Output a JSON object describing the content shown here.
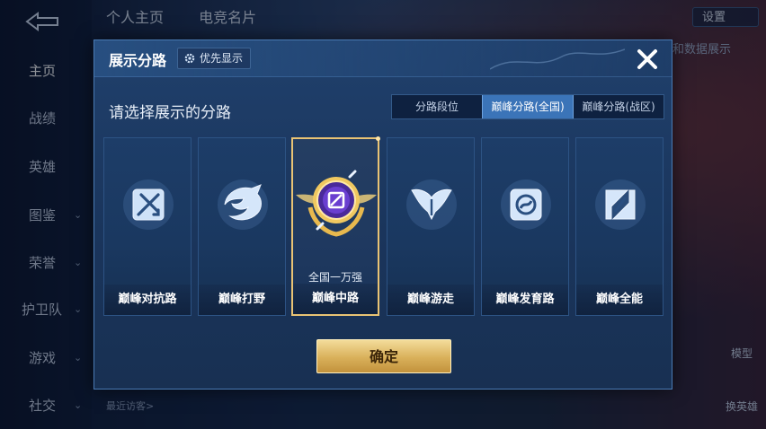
{
  "background": {
    "tabs": [
      "个人主页",
      "电竞名片"
    ],
    "settings_label": "设置",
    "right_note": "和数据展示",
    "model_label": "模型",
    "switch_hero_label": "换英雄",
    "recent_visitors_label": "最近访客>"
  },
  "sidebar": {
    "items": [
      {
        "label": "主页",
        "active": true
      },
      {
        "label": "战绩"
      },
      {
        "label": "英雄"
      },
      {
        "label": "图鉴"
      },
      {
        "label": "荣誉"
      },
      {
        "label": "护卫队"
      },
      {
        "label": "游戏"
      },
      {
        "label": "社交"
      }
    ]
  },
  "dialog": {
    "title": "展示分路",
    "priority_label": "优先显示",
    "subtitle": "请选择展示的分路",
    "segments": [
      {
        "label": "分路段位"
      },
      {
        "label": "巅峰分路(全国)",
        "active": true
      },
      {
        "label": "巅峰分路(战区)"
      }
    ],
    "cards": [
      {
        "label": "巅峰对抗路",
        "icon": "sword-cross-icon"
      },
      {
        "label": "巅峰打野",
        "icon": "dragon-icon"
      },
      {
        "label": "巅峰中路",
        "icon": "mid-lane-emblem-icon",
        "rank": "全国一万强",
        "selected": true
      },
      {
        "label": "巅峰游走",
        "icon": "wings-icon"
      },
      {
        "label": "巅峰发育路",
        "icon": "target-icon"
      },
      {
        "label": "巅峰全能",
        "icon": "allround-icon"
      }
    ],
    "confirm_label": "确定"
  },
  "colors": {
    "accent_blue": "#3b74b8",
    "gold": "#e9c374",
    "panel": "#1a355c"
  }
}
